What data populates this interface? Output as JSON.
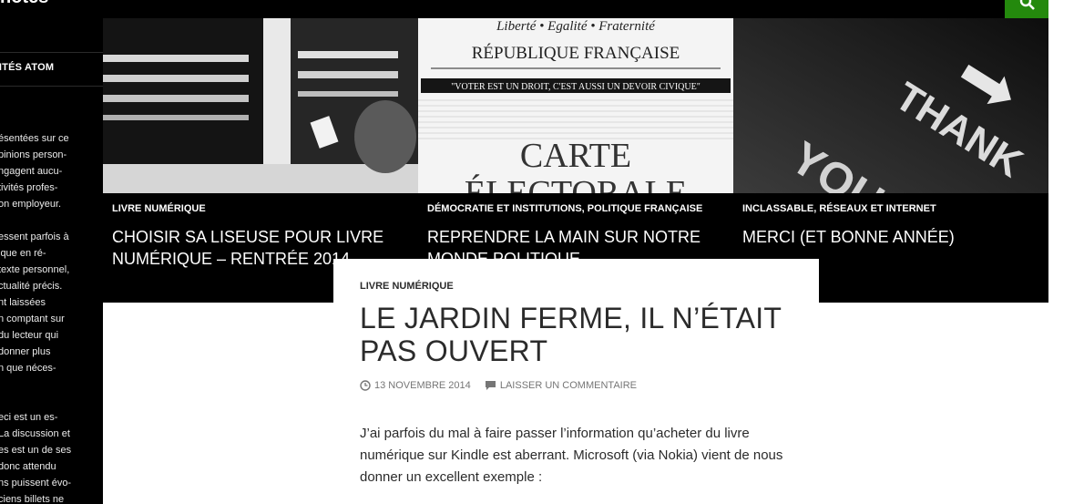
{
  "site": {
    "title_fragment": "notes",
    "top_links": "· · · · ·"
  },
  "sidebar": {
    "heading": "LITÉS ATOM",
    "lines_group1": [
      "ésentées sur ce",
      "pinions person-",
      "ngagent aucu-",
      "tivités profes-",
      "on employeur."
    ],
    "lines_group2": [
      "essent parfois à",
      "ique en ré-",
      "texte personnel,",
      "ctualité précis.",
      "nt laissées",
      "n comptant sur",
      "du lecteur qui",
      "donner plus",
      "n que néces-"
    ],
    "lines_group3": [
      "eci est un es-",
      "La discussion et",
      "es est un de ses",
      "donc attendu",
      "ns puissent évo-",
      "ciens billets ne"
    ]
  },
  "featured": [
    {
      "category": "LIVRE NUMÉRIQUE",
      "title": "CHOISIR SA LISEUSE POUR LIVRE NUMÉRIQUE – RENTRÉE 2014"
    },
    {
      "category": "DÉMOCRATIE ET INSTITUTIONS, POLITIQUE FRANÇAISE",
      "title": "REPRENDRE LA MAIN SUR NOTRE MONDE POLITIQUE",
      "image_text": {
        "motto": "Liberté • Egalité • Fraternité",
        "republic": "RÉPUBLIQUE FRANÇAISE",
        "slogan": "\"VOTER EST UN DROIT, C'EST AUSSI UN DEVOIR CIVIQUE\"",
        "card_line1": "CARTE",
        "card_line2": "ÉLECTORALE"
      }
    },
    {
      "category": "INCLASSABLE, RÉSEAUX ET INTERNET",
      "title": "MERCI (ET BONNE ANNÉE)",
      "image_text": {
        "road_word1": "THANK",
        "road_word2": "YOU"
      }
    }
  ],
  "post": {
    "category": "LIVRE NUMÉRIQUE",
    "title": "LE JARDIN FERME, IL N’ÉTAIT PAS OUVERT",
    "date": "13 NOVEMBRE 2014",
    "comment_link": "LAISSER UN COMMENTAIRE",
    "body": "J’ai parfois du mal à faire passer l’information qu’acheter du livre numérique sur Kindle est aberrant. Microsoft (via Nokia) vient de nous donner un excellent exemple :"
  },
  "colors": {
    "accent": "#24890d",
    "dark": "#000000",
    "text": "#2b2b2b",
    "meta": "#767676"
  },
  "icons": [
    "search-icon",
    "clock-icon",
    "comment-icon"
  ]
}
